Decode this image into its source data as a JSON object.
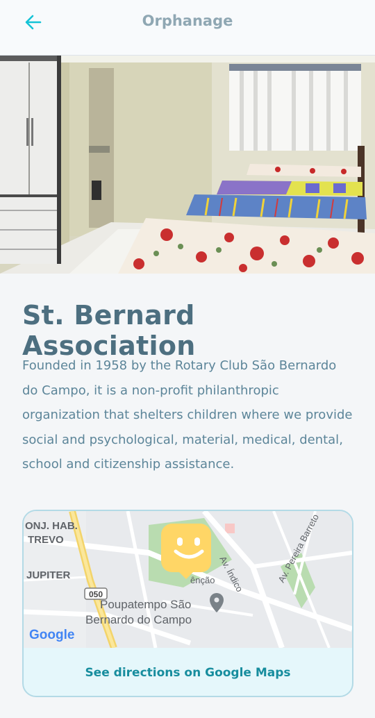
{
  "header": {
    "title": "Orphanage",
    "back_icon": "arrow-left-icon"
  },
  "hero": {
    "description": "orphanage bedroom photo"
  },
  "content": {
    "title": "St. Bernard Association",
    "description": "Founded in 1958 by the Rotary Club São Bernardo do Campo, it is a non-profit philanthropic organization that shelters children where we provide social and psychological, material, medical, dental, school and citizenship assistance."
  },
  "map": {
    "labels": {
      "area1_line1": "ONJ. HAB.",
      "area1_line2": "TREVO",
      "area2": "JUPITER",
      "road_badge": "050",
      "street1": "Av. Índico",
      "street2": "Av. Pereira Barreto",
      "street3": "ênção",
      "poi_line1": "Poupatempo São",
      "poi_line2": "Bernardo do Campo",
      "google": "Google"
    },
    "marker_icon": "smiley-marker-icon",
    "poi_icon": "map-pin-icon",
    "directions_label": "See directions on Google Maps"
  },
  "colors": {
    "accent": "#15c3d6",
    "title": "#4d6f80",
    "text": "#5c8599",
    "marker": "#ffd666"
  }
}
